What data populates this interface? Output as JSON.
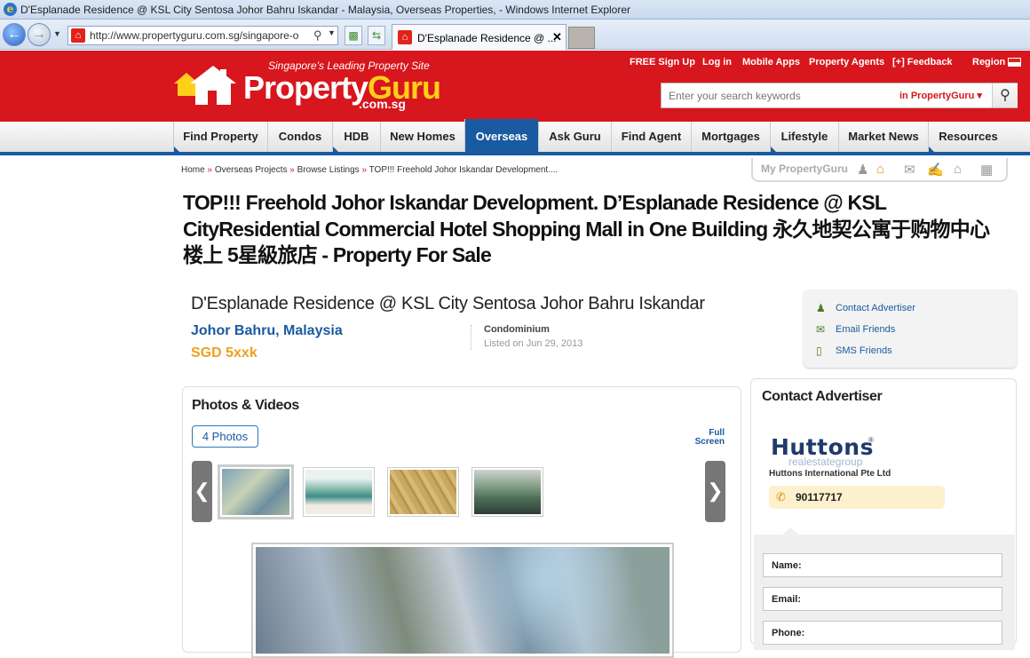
{
  "browser": {
    "window_title": "D'Esplanade Residence @ KSL City Sentosa Johor Bahru Iskandar - Malaysia, Overseas Properties,  - Windows Internet Explorer",
    "address": "http://www.propertyguru.com.sg/singapore-o",
    "tab_title": "D'Esplanade Residence @ ..."
  },
  "site": {
    "tagline": "Singapore's Leading Property Site",
    "logo_property": "Property",
    "logo_guru": "Guru",
    "logo_domain": ".com.sg",
    "top_links": [
      "FREE Sign Up",
      "Log in",
      "Mobile Apps",
      "Property Agents",
      "[+] Feedback",
      "Region"
    ],
    "search_placeholder": "Enter your search keywords",
    "search_scope": "in PropertyGuru"
  },
  "nav": {
    "items": [
      "Find Property",
      "Condos",
      "HDB",
      "New Homes",
      "Overseas",
      "Ask Guru",
      "Find Agent",
      "Mortgages",
      "Lifestyle",
      "Market News",
      "Resources"
    ],
    "active": "Overseas"
  },
  "breadcrumb": [
    "Home",
    "Overseas Projects",
    "Browse Listings",
    "TOP!!! Freehold Johor Iskandar Development...."
  ],
  "my_propertyguru": "My PropertyGuru",
  "page_title": "TOP!!! Freehold Johor Iskandar Development. D’Esplanade Residence @ KSL CityResidential Commercial Hotel Shopping Mall in One Building 永久地契公寓于购物中心楼上 5星級旅店 - Property For Sale",
  "listing": {
    "name": "D'Esplanade Residence @ KSL City Sentosa Johor Bahru Iskandar",
    "location": "Johor Bahru, Malaysia",
    "price": "SGD 5xxk",
    "type": "Condominium",
    "listed": "Listed on Jun 29, 2013"
  },
  "actions": [
    "Contact Advertiser",
    "Email Friends",
    "SMS Friends"
  ],
  "photos": {
    "heading": "Photos & Videos",
    "count_button": "4 Photos",
    "full_screen": "Full Screen",
    "prev": "❮",
    "next": "❯"
  },
  "contact": {
    "heading": "Contact Advertiser",
    "logo_name": "Huttons",
    "logo_sub": "realestategroup",
    "agency": "Huttons International Pte Ltd",
    "phone": "90117717",
    "fields": [
      "Name:",
      "Email:",
      "Phone:"
    ]
  },
  "colors": {
    "brand_red": "#d7161d",
    "brand_blue": "#1a5aa0",
    "price_orange": "#f0a01c",
    "logo_yellow": "#ffcf1a"
  }
}
